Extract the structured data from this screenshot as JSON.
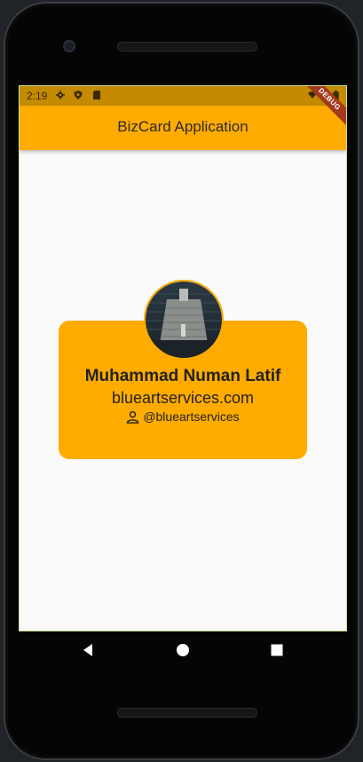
{
  "status_bar": {
    "time": "2:19",
    "icons": [
      "gear-icon",
      "shield-icon",
      "sd-card-icon",
      "wifi-icon",
      "signal-icon",
      "battery-icon"
    ]
  },
  "app_bar": {
    "title": "BizCard Application"
  },
  "debug_banner": {
    "label": "DEBUG"
  },
  "card": {
    "name": "Muhammad Numan Latif",
    "website": "blueartservices.com",
    "handle": "@blueartservices",
    "handle_icon": "person-icon"
  },
  "nav_bar": {
    "buttons": [
      "back-icon",
      "home-icon",
      "recents-icon"
    ]
  },
  "colors": {
    "accent": "#ffab00",
    "status_bar": "#c48a00",
    "background": "#fafafa",
    "debug_banner": "#a33a1e"
  }
}
